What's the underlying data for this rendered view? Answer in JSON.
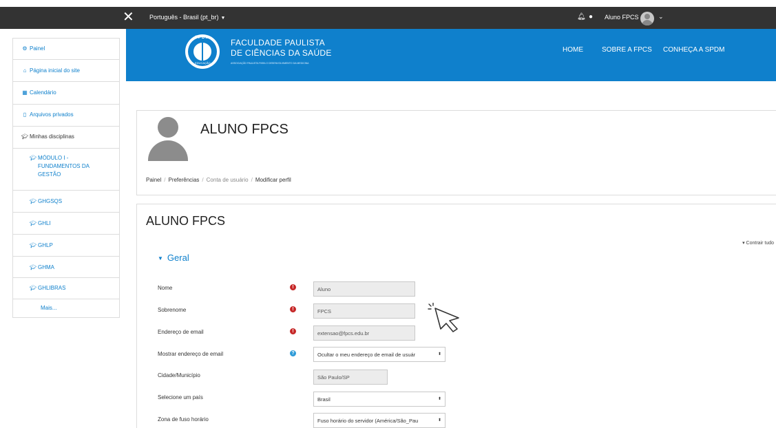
{
  "topbar": {
    "close_icon": "close-icon",
    "language": "Português - Brasil (pt_br)",
    "language_caret": "▼",
    "bell_icon": "bell-icon",
    "chat_icon": "chat-icon",
    "user_name": "Aluno FPCS",
    "user_caret": "⌄"
  },
  "brand": {
    "seal_top": "SPDM",
    "seal_bottom": "EDUCAÇÃO",
    "name_line1": "FACULDADE PAULISTA",
    "name_line2": "DE CIÊNCIAS DA SAÚDE",
    "tagline": "ASSOCIAÇÃO PAULISTA PARA O DESENVOLVIMENTO DA MEDICINA",
    "nav": [
      "HOME",
      "SOBRE A FPCS",
      "CONHEÇA A SPDM"
    ]
  },
  "sidebar": {
    "items": [
      {
        "label": "Painel",
        "icon": "dashboard-icon"
      },
      {
        "label": "Página inicial do site",
        "icon": "home-icon"
      },
      {
        "label": "Calendário",
        "icon": "calendar-icon"
      },
      {
        "label": "Arquivos privados",
        "icon": "file-icon"
      },
      {
        "label": "Minhas disciplinas",
        "icon": "graduation-cap-icon"
      },
      {
        "label_lines": [
          "MÓDULO I -",
          "FUNDAMENTOS DA",
          "GESTÃO"
        ],
        "icon": "graduation-cap-icon"
      },
      {
        "label": "GHGSQS",
        "icon": "graduation-cap-icon"
      },
      {
        "label": "GHLI",
        "icon": "graduation-cap-icon"
      },
      {
        "label": "GHLP",
        "icon": "graduation-cap-icon"
      },
      {
        "label": "GHMA",
        "icon": "graduation-cap-icon"
      },
      {
        "label": "GHLIBRAS",
        "icon": "graduation-cap-icon"
      },
      {
        "label": "Mais..."
      }
    ]
  },
  "profile_header": {
    "title": "ALUNO FPCS",
    "breadcrumb": [
      "Painel",
      "Preferências",
      "Conta de usuário",
      "Modificar perfil"
    ],
    "separator": "/"
  },
  "form": {
    "title": "ALUNO FPCS",
    "collapse_all": "Contrair tudo",
    "section": "Geral",
    "fields": [
      {
        "label": "Nome",
        "value": "Aluno",
        "marker": "required"
      },
      {
        "label": "Sobrenome",
        "value": "FPCS",
        "marker": "required"
      },
      {
        "label": "Endereço de email",
        "value": "extensao@fpcs.edu.br",
        "marker": "required"
      },
      {
        "label": "Mostrar endereço de email",
        "value": "Ocultar o meu endereço de email de usuár",
        "marker": "help"
      },
      {
        "label": "Cidade/Município",
        "value": "São Paulo/SP"
      },
      {
        "label": "Selecione um país",
        "value": "Brasil"
      },
      {
        "label": "Zona de fuso horário",
        "value": "Fuso horário do servidor (América/São_Pau"
      }
    ],
    "required_glyph": "!",
    "help_glyph": "?",
    "select_arrow": "⬍"
  },
  "colors": {
    "brand_blue": "#0f80cc",
    "topbar": "#333333",
    "required_red": "#c62828",
    "help_blue": "#2d9bd8"
  }
}
